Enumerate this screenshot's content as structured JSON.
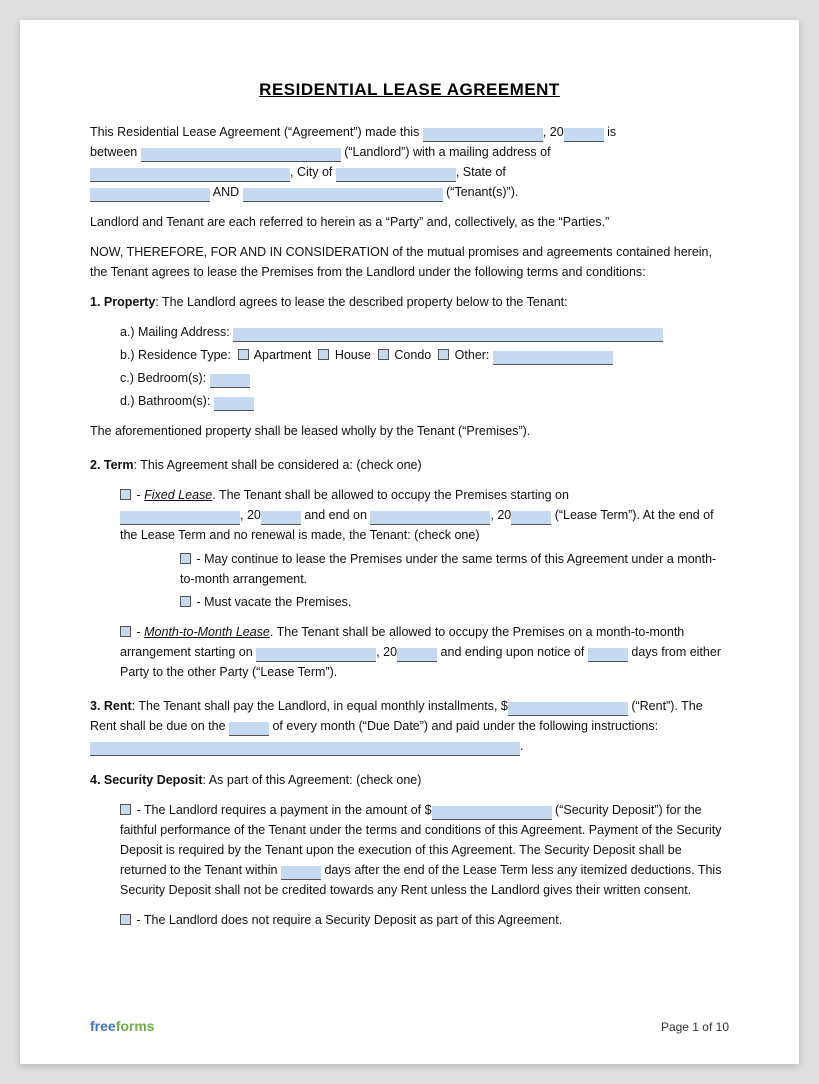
{
  "title": "RESIDENTIAL LEASE AGREEMENT",
  "intro": {
    "line1a": "This Residential Lease Agreement (“Agreement”) made this ",
    "line1b": ", 20",
    "line1c": " is",
    "line2a": "between ",
    "line2b": " (“Landlord”) with a mailing address of",
    "line3a": ", City of ",
    "line3b": ", State of",
    "line4a": " AND ",
    "line4b": " (“Tenant(s)”)."
  },
  "parties_note": "Landlord and Tenant are each referred to herein as a “Party” and, collectively, as the “Parties.”",
  "consideration": "NOW, THEREFORE, FOR AND IN CONSIDERATION of the mutual promises and agreements contained herein, the Tenant agrees to lease the Premises from the Landlord under the following terms and conditions:",
  "section1": {
    "header": "1. Property",
    "text": ": The Landlord agrees to lease the described property below to the Tenant:",
    "a_label": "a.)  Mailing Address:",
    "b_label": "b.)  Residence Type:",
    "b_options": [
      "Apartment",
      "House",
      "Condo",
      "Other:"
    ],
    "c_label": "c.)  Bedroom(s):",
    "d_label": "d.)  Bathroom(s):",
    "closing": "The aforementioned property shall be leased wholly by the Tenant (“Premises”)."
  },
  "section2": {
    "header": "2. Term",
    "text": ": This Agreement shall be considered a: (check one)",
    "fixed_label": "Fixed Lease",
    "fixed_text1": ". The Tenant shall be allowed to occupy the Premises starting on",
    "fixed_text2": ", 20",
    "fixed_text3": " and end on ",
    "fixed_text4": ", 20",
    "fixed_text5": " (“Lease Term”). At the end of the Lease Term and no renewal is made, the Tenant: (check one)",
    "option1": "- May continue to lease the Premises under the same terms of this Agreement under a month-to-month arrangement.",
    "option2": "- Must vacate the Premises.",
    "month_label": "Month-to-Month Lease",
    "month_text1": ". The Tenant shall be allowed to occupy the Premises on a month-to-month arrangement starting on ",
    "month_text2": ", 20",
    "month_text3": " and ending upon notice of ",
    "month_text4": " days from either Party to the other Party (“Lease Term”)."
  },
  "section3": {
    "header": "3. Rent",
    "text1": ": The Tenant shall pay the Landlord, in equal monthly installments, $",
    "text2": " (“Rent”). The Rent shall be due on the ",
    "text3": " of every month (“Due Date”) and paid under the following instructions: ",
    "text3_end": "."
  },
  "section4": {
    "header": "4. Security Deposit",
    "text": ": As part of this Agreement: (check one)",
    "option1_text1": "- The Landlord requires a payment in the amount of $",
    "option1_text2": " (“Security Deposit”) for the faithful performance of the Tenant under the terms and conditions of this Agreement. Payment of the Security Deposit is required by the Tenant upon the execution of this Agreement. The Security Deposit shall be returned to the Tenant within ",
    "option1_text3": " days after the end of the Lease Term less any itemized deductions. This Security Deposit shall not be credited towards any Rent unless the Landlord gives their written consent.",
    "option2_text": "- The Landlord does not require a Security Deposit as part of this Agreement."
  },
  "footer": {
    "logo_free": "free",
    "logo_forms": "forms",
    "page_label": "Page 1 of 10"
  }
}
